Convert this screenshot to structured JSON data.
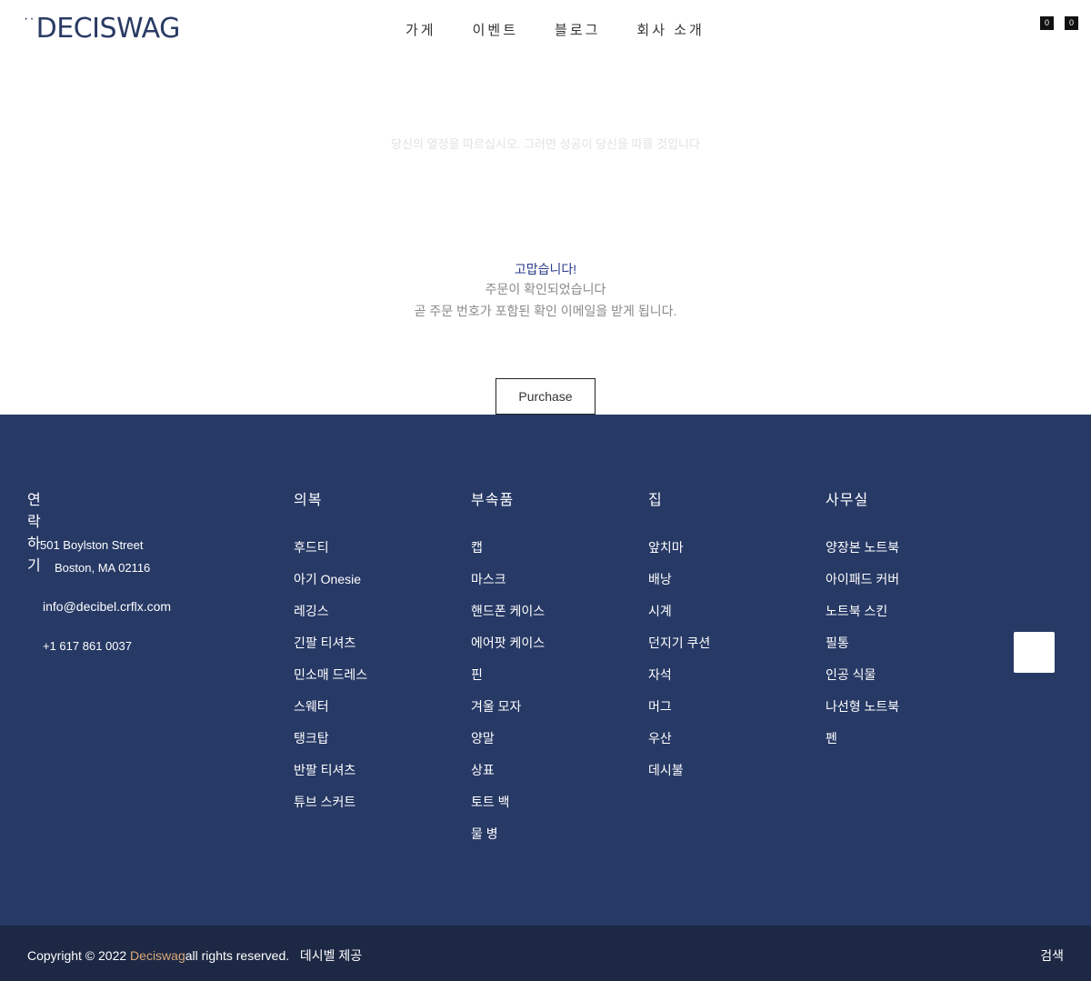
{
  "header": {
    "logo_dots": "··",
    "logo_text": "DECISWAG",
    "nav": [
      "가게",
      "이벤트",
      "블로그",
      "회사 소개"
    ],
    "cart_count": "0",
    "wishlist_count": "0"
  },
  "hero": {
    "tagline": "당신의 열정을 따르십시오. 그러면 성공이 당신을 따를 것입니다"
  },
  "thanks": {
    "title": "고맙습니다!",
    "line1": "주문이 확인되었습니다",
    "line2": "곧 주문 번호가 포함된 확인 이메일을 받게 됩니다.",
    "button": "Purchase"
  },
  "footer": {
    "contact": {
      "title": "연락하기",
      "address_line1": "501 Boylston Street",
      "address_line2": "Boston, MA 02116",
      "email": "info@decibel.crflx.com",
      "phone": "+1 617 861 0037"
    },
    "columns": [
      {
        "title": "의복",
        "items": [
          "후드티",
          "아기 Onesie",
          "레깅스",
          "긴팔 티셔츠",
          "민소매 드레스",
          "스웨터",
          "탱크탑",
          "반팔 티셔츠",
          "튜브 스커트"
        ]
      },
      {
        "title": "부속품",
        "items": [
          "캡",
          "마스크",
          "핸드폰 케이스",
          "에어팟 케이스",
          "핀",
          "겨울 모자",
          "양말",
          "상표",
          "토트 백",
          "물 병"
        ]
      },
      {
        "title": "집",
        "items": [
          "앞치마",
          "배낭",
          "시계",
          "던지기 쿠션",
          "자석",
          "머그",
          "우산",
          "데시불"
        ]
      },
      {
        "title": "사무실",
        "items": [
          "양장본 노트북",
          "아이패드 커버",
          "노트북 스킨",
          "필통",
          "인공 식물",
          "나선형 노트북",
          "펜"
        ]
      }
    ]
  },
  "bottom": {
    "copyright_prefix": "Copyright © 2022 ",
    "brand": "Deciswag",
    "copyright_suffix": "all rights reserved.",
    "powered": "데시벨 제공",
    "search": "검색"
  }
}
